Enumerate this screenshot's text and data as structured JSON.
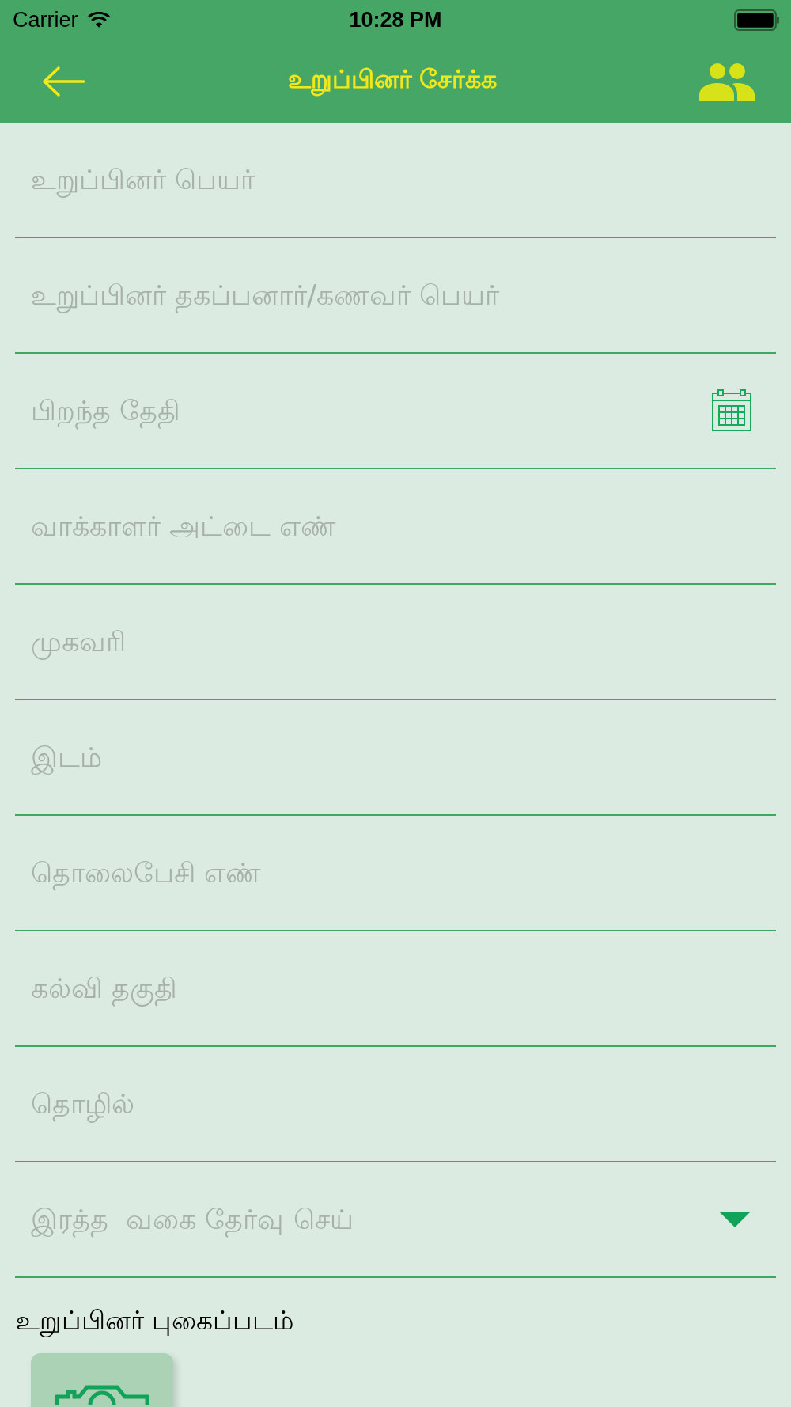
{
  "status_bar": {
    "carrier": "Carrier",
    "time": "10:28 PM"
  },
  "header": {
    "title": "உறுப்பினர் சேர்க்க"
  },
  "fields": [
    {
      "kind": "text",
      "placeholder": "உறுப்பினர் பெயர்"
    },
    {
      "kind": "text",
      "placeholder": "உறுப்பினர் தகப்பனார்/கணவர் பெயர்"
    },
    {
      "kind": "date",
      "placeholder": "பிறந்த தேதி"
    },
    {
      "kind": "text",
      "placeholder": "வாக்காளர் அட்டை எண்"
    },
    {
      "kind": "text",
      "placeholder": "முகவரி"
    },
    {
      "kind": "text",
      "placeholder": "இடம்"
    },
    {
      "kind": "text",
      "placeholder": "தொலைபேசி எண்"
    },
    {
      "kind": "text",
      "placeholder": "கல்வி தகுதி"
    },
    {
      "kind": "text",
      "placeholder": "தொழில்"
    },
    {
      "kind": "select",
      "placeholder": "இரத்த  வகை தேர்வு செய்"
    }
  ],
  "photo": {
    "label": "உறுப்பினர் புகைப்படம்"
  }
}
